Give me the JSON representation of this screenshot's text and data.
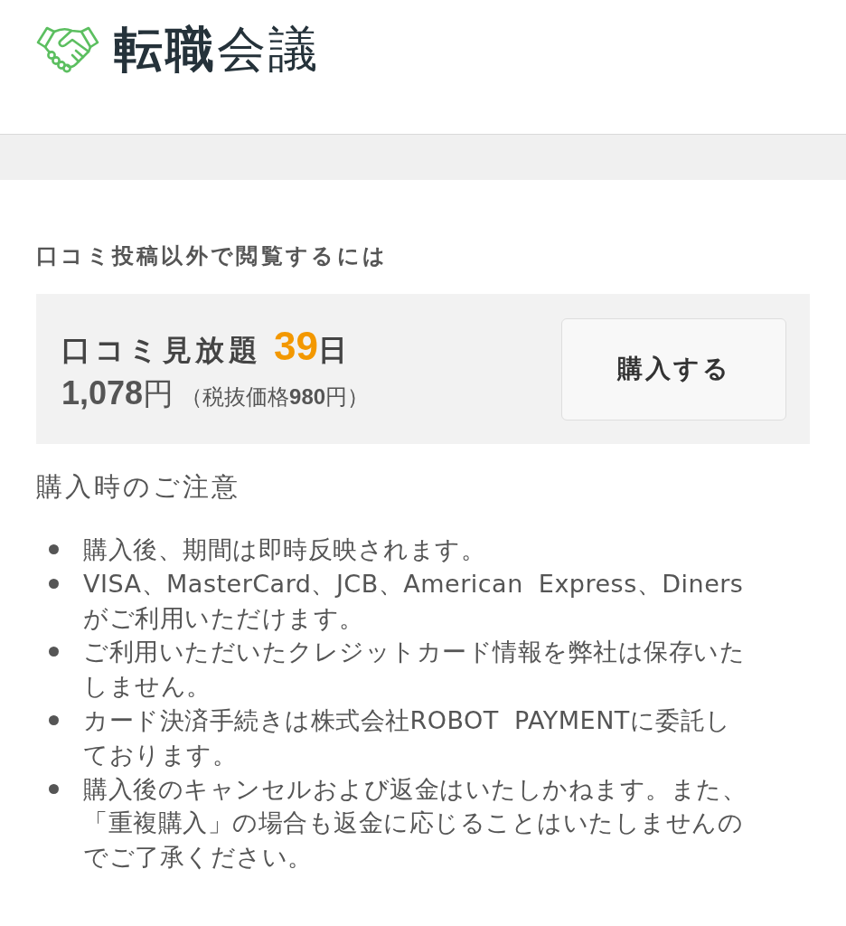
{
  "header": {
    "logo_text": "**転職**会議"
  },
  "purchase": {
    "heading": "口コミ投稿以外で閲覧するには",
    "plan": {
      "name": "口コミ見放題",
      "days": "39",
      "days_unit": "日",
      "price": "**1,078**円",
      "tax_note": "（税抜価格**980**円）",
      "button": "購入する"
    }
  },
  "notes": {
    "heading": "購入時のご注意",
    "items": [
      "購入後、期間は即時反映されます。",
      "VISA、MasterCard、JCB、American Express、Dinersがご利用いただけます。",
      "ご利用いただいたクレジットカード情報を弊社は保存いたしません。",
      "カード決済手続きは株式会社ROBOT PAYMENTに委託しております。",
      "購入後のキャンセルおよび返金はいたしかねます。また、「重複購入」の場合も返金に応じることはいたしませんのでご了承ください。"
    ]
  }
}
